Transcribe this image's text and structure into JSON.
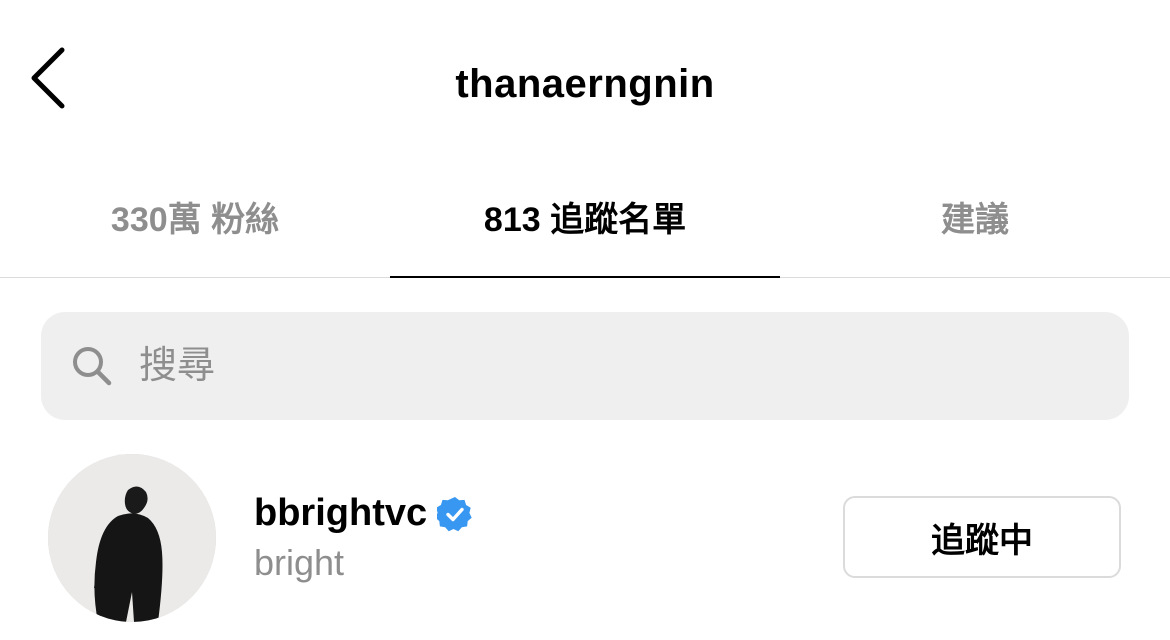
{
  "header": {
    "title": "thanaerngnin",
    "back_icon": "chevron-left-icon"
  },
  "tabs": [
    {
      "label": "330萬 粉絲",
      "active": false
    },
    {
      "label": "813 追蹤名單",
      "active": true
    },
    {
      "label": "建議",
      "active": false
    }
  ],
  "search": {
    "placeholder": "搜尋",
    "value": "",
    "icon": "search-icon"
  },
  "list": {
    "items": [
      {
        "username": "bbrightvc",
        "full_name": "bright",
        "verified": true,
        "verified_color": "#3897f0",
        "button_label": "追蹤中"
      }
    ]
  }
}
